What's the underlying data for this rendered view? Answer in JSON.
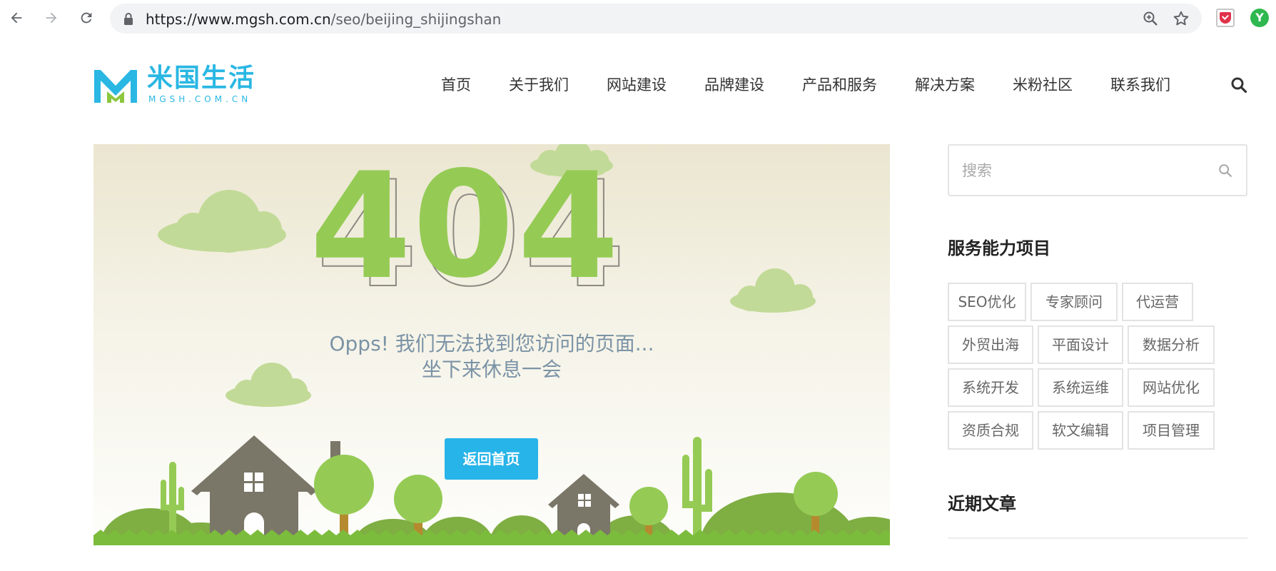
{
  "browser": {
    "url_host": "https://www.mgsh.com.cn",
    "url_path": "/seo/beijing_shijingshan"
  },
  "logo": {
    "cn": "米国生活",
    "en": "MGSH.COM.CN"
  },
  "nav": {
    "items": [
      "首页",
      "关于我们",
      "网站建设",
      "品牌建设",
      "产品和服务",
      "解决方案",
      "米粉社区",
      "联系我们"
    ]
  },
  "hero": {
    "code": "404",
    "line1": "Opps! 我们无法找到您访问的页面...",
    "line2": "坐下来休息一会",
    "button": "返回首页"
  },
  "sidebar": {
    "search_placeholder": "搜索",
    "services_title": "服务能力项目",
    "tags": [
      "SEO优化",
      "专家顾问",
      "代运营",
      "外贸出海",
      "平面设计",
      "数据分析",
      "系统开发",
      "系统运维",
      "网站优化",
      "资质合规",
      "软文编辑",
      "项目管理"
    ],
    "recent_title": "近期文章"
  },
  "colors": {
    "brand": "#2ab7e3",
    "button": "#27b4e8",
    "green": "#95cb55"
  }
}
